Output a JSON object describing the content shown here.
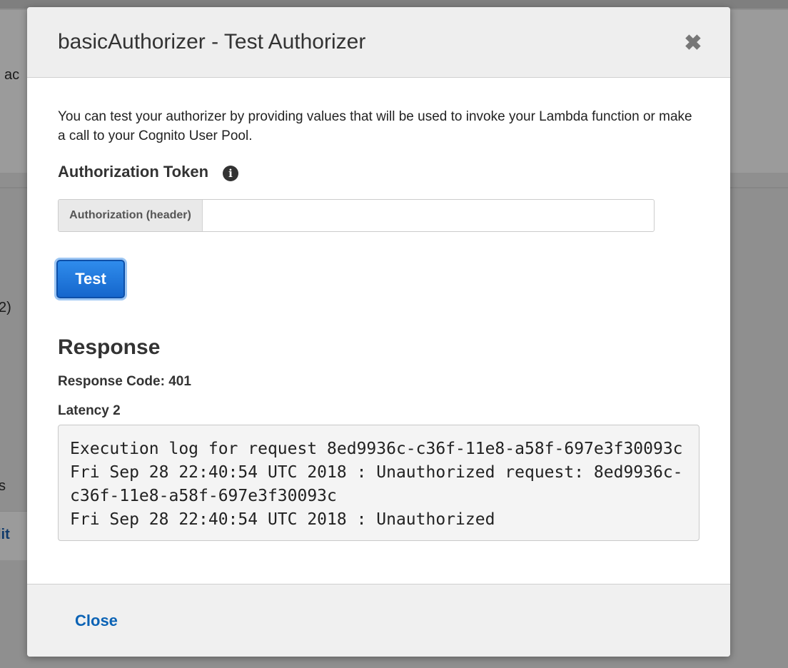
{
  "background": {
    "fragments": [
      "l ac",
      "2)",
      "s"
    ],
    "link_fragment": "lit"
  },
  "modal": {
    "title": "basicAuthorizer - Test Authorizer",
    "close_icon": "close-icon",
    "intro": "You can test your authorizer by providing values that will be used to invoke your Lambda function or make a call to your Cognito User Pool.",
    "token_section": {
      "label": "Authorization Token",
      "info_icon": "info-icon",
      "info_glyph": "i",
      "addon_label": "Authorization (header)",
      "value": "",
      "placeholder": ""
    },
    "test_button": "Test",
    "response": {
      "title": "Response",
      "code_line": "Response Code: 401",
      "latency_line": "Latency 2",
      "log": "Execution log for request 8ed9936c-c36f-11e8-a58f-697e3f30093c\nFri Sep 28 22:40:54 UTC 2018 : Unauthorized request: 8ed9936c-c36f-11e8-a58f-697e3f30093c\nFri Sep 28 22:40:54 UTC 2018 : Unauthorized"
    },
    "footer": {
      "close_label": "Close"
    }
  },
  "colors": {
    "accent": "#1566cc",
    "link": "#0b63b5",
    "overlay": "#8f8f8f"
  }
}
